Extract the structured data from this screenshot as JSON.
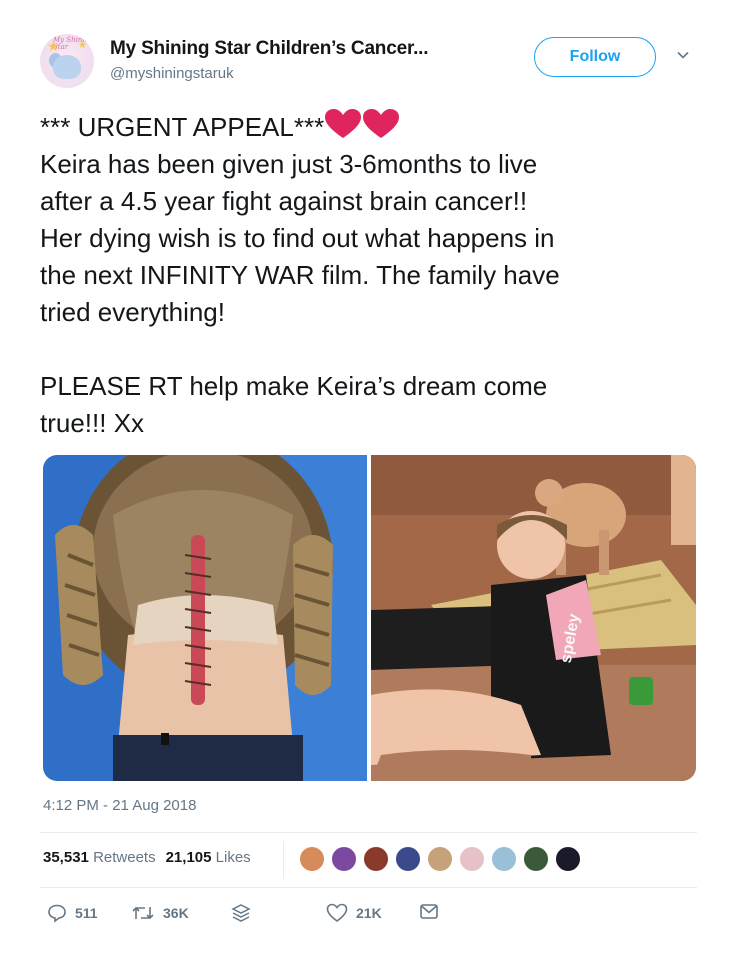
{
  "author": {
    "name": "My Shining Star Children’s Cancer...",
    "handle": "@myshiningstaruk",
    "avatar_text": "My Shining Star"
  },
  "follow_label": "Follow",
  "tweet": {
    "lines": [
      "*** URGENT APPEAL***",
      "Keira has been given just 3-6months to live",
      "after a 4.5 year fight against brain cancer!!",
      "Her dying wish is to find out what happens in",
      "the next INFINITY WAR film. The family have",
      "tried everything!",
      "PLEASE RT help make Keira’s dream come",
      "true!!! Xx"
    ],
    "heart_icon": "red-heart-emoji"
  },
  "media": [
    {
      "description_icon": "photo-back-of-head"
    },
    {
      "description_icon": "photo-girl-at-beach",
      "wetsuit_text": "speley"
    }
  ],
  "timestamp": "4:12 PM - 21 Aug 2018",
  "stats": {
    "retweets_count": "35,531",
    "retweets_label": "Retweets",
    "likes_count": "21,105",
    "likes_label": "Likes"
  },
  "actions": {
    "replies": "511",
    "retweets": "36K",
    "likes": "21K"
  },
  "colors": {
    "accent": "#1da1f2",
    "text": "#14171a",
    "muted": "#657786",
    "divider": "#e6ecf0",
    "heart": "#e0245e"
  }
}
